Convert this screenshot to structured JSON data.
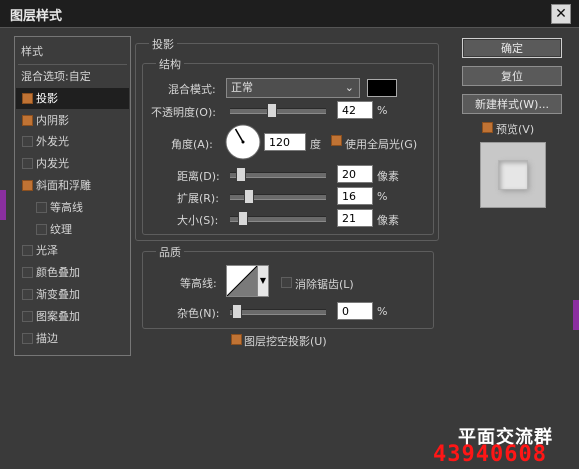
{
  "window": {
    "title": "图层样式",
    "close_glyph": "✕"
  },
  "left_list": {
    "header": "样式",
    "items": [
      {
        "label": "混合选项:自定",
        "checkbox": false
      },
      {
        "label": "投影",
        "checkbox": true,
        "checked": true,
        "selected": true
      },
      {
        "label": "内阴影",
        "checkbox": true,
        "checked": true
      },
      {
        "label": "外发光",
        "checkbox": true,
        "checked": false
      },
      {
        "label": "内发光",
        "checkbox": true,
        "checked": false
      },
      {
        "label": "斜面和浮雕",
        "checkbox": true,
        "checked": true
      },
      {
        "label": "等高线",
        "checkbox": true,
        "checked": false,
        "indent": true
      },
      {
        "label": "纹理",
        "checkbox": true,
        "checked": false,
        "indent": true
      },
      {
        "label": "光泽",
        "checkbox": true,
        "checked": false
      },
      {
        "label": "颜色叠加",
        "checkbox": true,
        "checked": false
      },
      {
        "label": "渐变叠加",
        "checkbox": true,
        "checked": false
      },
      {
        "label": "图案叠加",
        "checkbox": true,
        "checked": false
      },
      {
        "label": "描边",
        "checkbox": true,
        "checked": false
      }
    ]
  },
  "section": {
    "title": "投影",
    "structure": {
      "title": "结构",
      "blend_mode_label": "混合模式:",
      "blend_mode_value": "正常",
      "opacity_label": "不透明度(O):",
      "opacity_value": "42",
      "opacity_pct": 42,
      "angle_label": "角度(A):",
      "angle_value": "120",
      "angle_unit": "度",
      "global_light_label": "使用全局光(G)",
      "global_light_checked": true,
      "distance_label": "距离(D):",
      "distance_value": "20",
      "distance_unit": "像素",
      "distance_fraction": 0.07,
      "spread_label": "扩展(R):",
      "spread_value": "16",
      "spread_unit": "%",
      "spread_fraction": 0.16,
      "size_label": "大小(S):",
      "size_value": "21",
      "size_unit": "像素",
      "size_fraction": 0.09,
      "percent": "%"
    },
    "quality": {
      "title": "品质",
      "contour_label": "等高线:",
      "antialias_label": "消除锯齿(L)",
      "antialias_checked": false,
      "noise_label": "杂色(N):",
      "noise_value": "0",
      "noise_unit": "%"
    },
    "knockout_label": "图层挖空投影(U)",
    "knockout_checked": true
  },
  "buttons": {
    "ok": "确定",
    "reset": "复位",
    "new_style": "新建样式(W)...",
    "preview_label": "预览(V)",
    "preview_checked": true
  },
  "watermark": {
    "line1": "平面交流群",
    "line2": "43940608"
  },
  "colors": {
    "accent_checkbox": "#c07334",
    "watermark_red": "#ff1616",
    "dialog_bg": "#3a3a3a"
  }
}
